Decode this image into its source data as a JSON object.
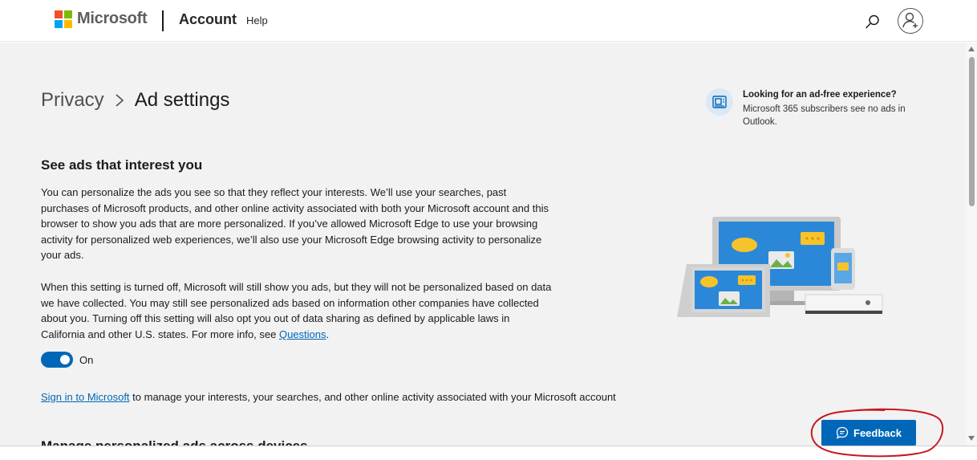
{
  "header": {
    "brand": "Microsoft",
    "section": "Account",
    "help": "Help",
    "search_icon": "search-icon",
    "avatar_icon": "add-user-icon"
  },
  "breadcrumb": {
    "parent": "Privacy",
    "current": "Ad settings"
  },
  "promo": {
    "title": "Looking for an ad-free experience?",
    "text": "Microsoft 365 subscribers see no ads in Outlook."
  },
  "section": {
    "title": "See ads that interest you",
    "paragraph1": "You can personalize the ads you see so that they reflect your interests. We’ll use your searches, past purchases of Microsoft products, and other online activity associated with both your Microsoft account and this browser to show you ads that are more personalized. If you’ve allowed Microsoft Edge to use your browsing activity for personalized web experiences, we’ll also use your Microsoft Edge browsing activity to personalize your ads.",
    "paragraph2": "When this setting is turned off, Microsoft will still show you ads, but they will not be personalized based on data we have collected. You may still see personalized ads based on information other companies have collected about you. Turning off this setting will also opt you out of data sharing as defined by applicable laws in California and other U.S. states. For more info, see ",
    "questions_link": "Questions",
    "paragraph2_end": ".",
    "toggle_label": "On",
    "toggle_on": true
  },
  "signin": {
    "link": "Sign in to Microsoft",
    "text": " to manage your interests, your searches, and other online activity associated with your Microsoft account"
  },
  "next_heading": "Manage personalized ads across devices",
  "feedback": {
    "label": "Feedback"
  },
  "colors": {
    "accent": "#0067b8",
    "annotation": "#c8161d"
  }
}
